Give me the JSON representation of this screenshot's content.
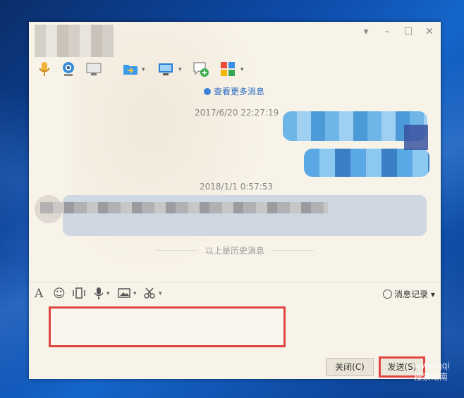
{
  "window": {
    "controls": {
      "options": "▾",
      "minimize": "–",
      "maximize": "☐",
      "close": "✕"
    }
  },
  "toolbar": {
    "caret": "▾"
  },
  "chat": {
    "more_messages": "查看更多消息",
    "timestamp_1": "2017/6/20 22:27:19",
    "timestamp_2": "2018/1/1 0:57:53",
    "history_divider": "以上是历史消息"
  },
  "input_toolbar": {
    "font_icon": "A",
    "emoji_icon": "☺",
    "caret": "▾",
    "history_label": "消息记录"
  },
  "buttons": {
    "close_label": "关闭(C)",
    "send_label": "发送(S)"
  },
  "watermark": "www.qqi搜索站南"
}
